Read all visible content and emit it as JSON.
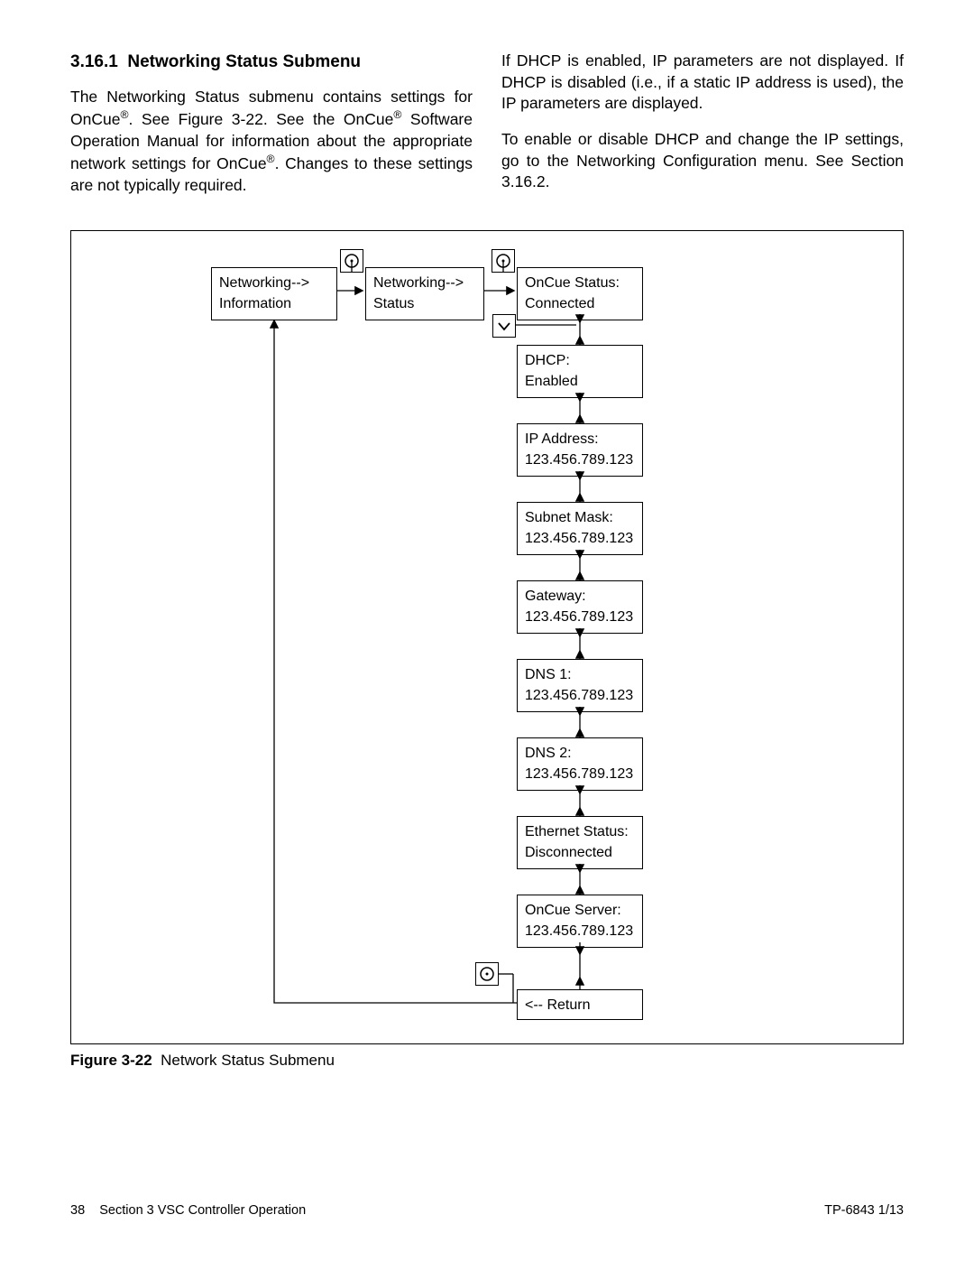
{
  "section": {
    "number": "3.16.1",
    "title": "Networking Status Submenu"
  },
  "paragraphs": {
    "p1a": "The Networking Status submenu contains settings for OnCue",
    "p1b": ".  See Figure 3-22.  See the OnCue",
    "p1c": " Software Operation Manual for information about the appropriate network settings for OnCue",
    "p1d": ".  Changes to these settings are not typically required.",
    "p2": "If DHCP is enabled, IP parameters are not displayed. If DHCP is disabled (i.e., if a static IP address is used), the IP parameters are displayed.",
    "p3": "To enable or disable DHCP and change the IP settings, go to the Networking Configuration menu. See Section 3.16.2."
  },
  "reg": "®",
  "figure": {
    "label": "Figure 3-22",
    "caption": "Network Status Submenu"
  },
  "nodes": {
    "net_info": {
      "l1": "Networking-->",
      "l2": "Information"
    },
    "net_status": {
      "l1": "Networking-->",
      "l2": "Status"
    },
    "oncue_status": {
      "l1": "OnCue Status:",
      "l2": "Connected"
    },
    "dhcp": {
      "l1": "DHCP:",
      "l2": "Enabled"
    },
    "ip": {
      "l1": "IP Address:",
      "l2": "123.456.789.123"
    },
    "subnet": {
      "l1": "Subnet Mask:",
      "l2": "123.456.789.123"
    },
    "gateway": {
      "l1": "Gateway:",
      "l2": "123.456.789.123"
    },
    "dns1": {
      "l1": "DNS 1:",
      "l2": "123.456.789.123"
    },
    "dns2": {
      "l1": "DNS 2:",
      "l2": "123.456.789.123"
    },
    "eth": {
      "l1": "Ethernet Status:",
      "l2": "Disconnected"
    },
    "server": {
      "l1": "OnCue Server:",
      "l2": "123.456.789.123"
    },
    "ret": {
      "l1": "<-- Return"
    }
  },
  "footer": {
    "left_page": "38",
    "left_text": "Section 3  VSC Controller Operation",
    "right": "TP-6843   1/13"
  }
}
